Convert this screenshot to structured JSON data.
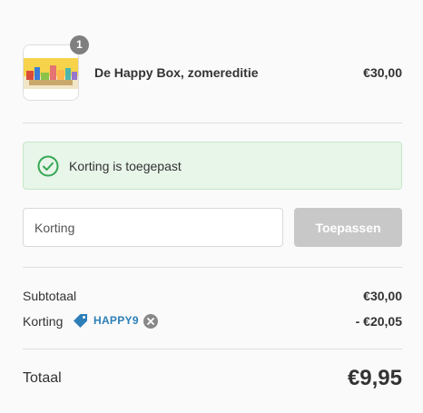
{
  "line_item": {
    "quantity": "1",
    "name": "De Happy Box, zomereditie",
    "price": "€30,00",
    "image_alt": "product-thumbnail"
  },
  "discount_notice": {
    "text": "Korting is toegepast",
    "icon": "check-circle-icon",
    "color": "#34a853"
  },
  "discount_form": {
    "placeholder": "Korting",
    "apply_label": "Toepassen"
  },
  "summary": {
    "subtotal_label": "Subtotaal",
    "subtotal_value": "€30,00",
    "discount_label": "Korting",
    "discount_code": "HAPPY9",
    "discount_value": "- €20,05",
    "total_label": "Totaal",
    "total_value": "€9,95"
  },
  "colors": {
    "accent": "#2d7fb8",
    "success_bg": "#e8f5e9",
    "button_disabled": "#c8c8c8"
  }
}
